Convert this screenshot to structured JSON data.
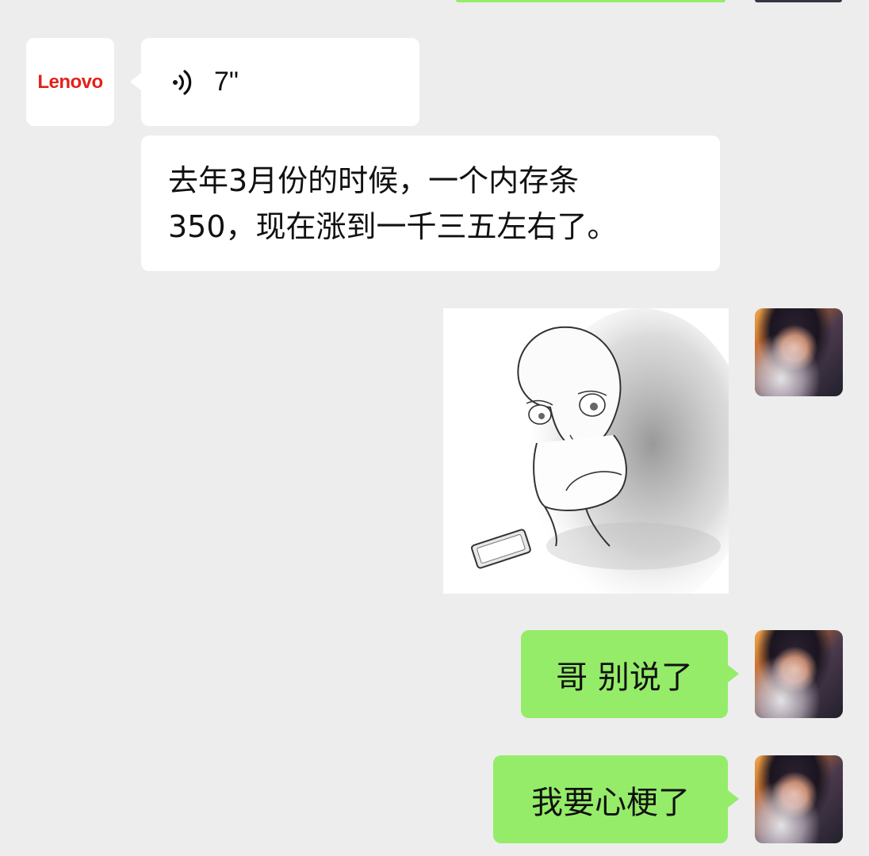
{
  "contact": {
    "avatar_logo_text": "Lenovo",
    "avatar_logo_color": "#e2231a"
  },
  "messages": [
    {
      "type": "voice",
      "from": "contact",
      "duration": "7\""
    },
    {
      "type": "text",
      "from": "contact",
      "lines": [
        "去年3月份的时候，一个内存条",
        "350，现在涨到一千三五左右了。"
      ]
    },
    {
      "type": "sticker",
      "from": "me",
      "subject": "sad-sketch-figure-hugging-knees-with-phone"
    },
    {
      "type": "text",
      "from": "me",
      "text": "哥 别说了"
    },
    {
      "type": "text",
      "from": "me",
      "text": "我要心梗了"
    }
  ],
  "colors": {
    "background": "#ededed",
    "incoming_bubble": "#ffffff",
    "outgoing_bubble": "#95ec69"
  },
  "icons": {
    "voice": "voice-wave-icon"
  }
}
